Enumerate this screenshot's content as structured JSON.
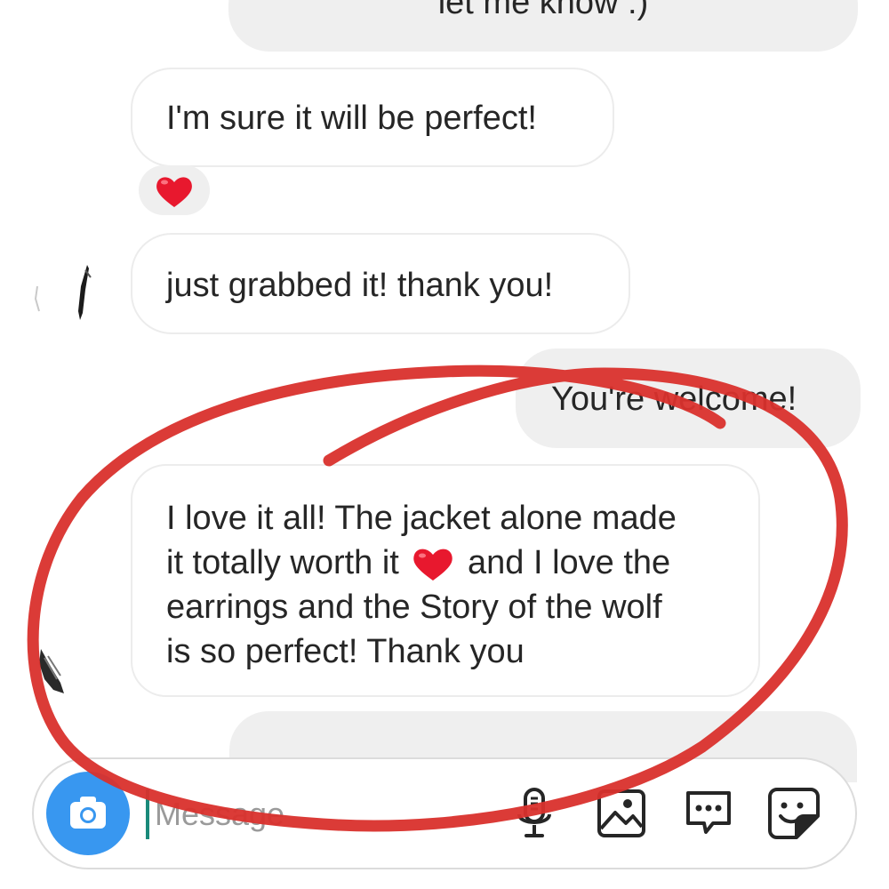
{
  "conversation": {
    "messages": [
      {
        "side": "outgoing",
        "text": "let me know :)"
      },
      {
        "side": "incoming",
        "text": "I'm sure it will be perfect!"
      },
      {
        "side": "incoming",
        "text": "just grabbed it! thank you!"
      },
      {
        "side": "outgoing",
        "text": "You're welcome!"
      },
      {
        "side": "incoming",
        "lines": [
          "I love it all! The jacket alone made",
          "it totally worth it",
          "and I love the",
          "earrings and the Story of the wolf",
          "is so perfect! Thank you"
        ]
      }
    ],
    "reaction": "heart-emoji"
  },
  "composer": {
    "placeholder": "Message",
    "camera_icon": "camera-icon",
    "tools": [
      "microphone-icon",
      "gallery-icon",
      "chat-bubble-icon",
      "sticker-icon"
    ]
  },
  "colors": {
    "incoming_bubble": "#ffffff",
    "outgoing_bubble": "#efefef",
    "camera_button": "#3897f0",
    "annotation": "#d9302c",
    "heart": "#e8182e"
  }
}
